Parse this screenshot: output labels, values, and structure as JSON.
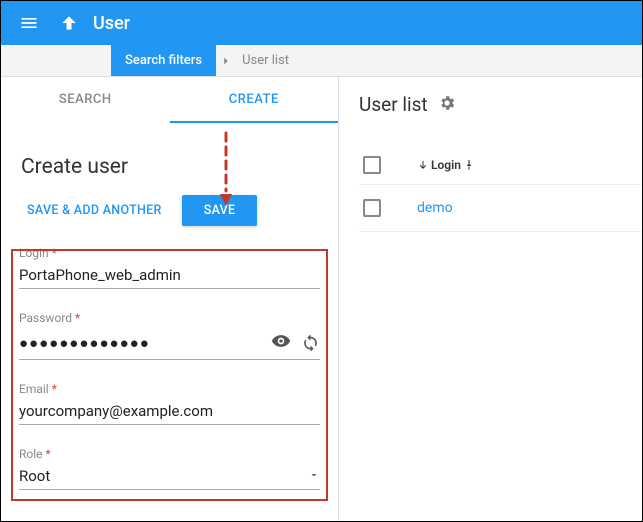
{
  "topbar": {
    "title": "User"
  },
  "breadcrumb": {
    "active": "Search filters",
    "items": [
      "User list"
    ]
  },
  "tabs": {
    "search": "SEARCH",
    "create": "CREATE"
  },
  "form": {
    "title": "Create user",
    "buttons": {
      "save_add": "SAVE & ADD ANOTHER",
      "save": "SAVE"
    },
    "fields": {
      "login": {
        "label": "Login",
        "value": "PortaPhone_web_admin"
      },
      "password": {
        "label": "Password",
        "value": "●●●●●●●●●●●●●"
      },
      "email": {
        "label": "Email",
        "value": "yourcompany@example.com"
      },
      "role": {
        "label": "Role",
        "value": "Root"
      }
    }
  },
  "panel": {
    "title": "User list",
    "column": "Login",
    "rows": [
      {
        "login": "demo"
      }
    ]
  }
}
